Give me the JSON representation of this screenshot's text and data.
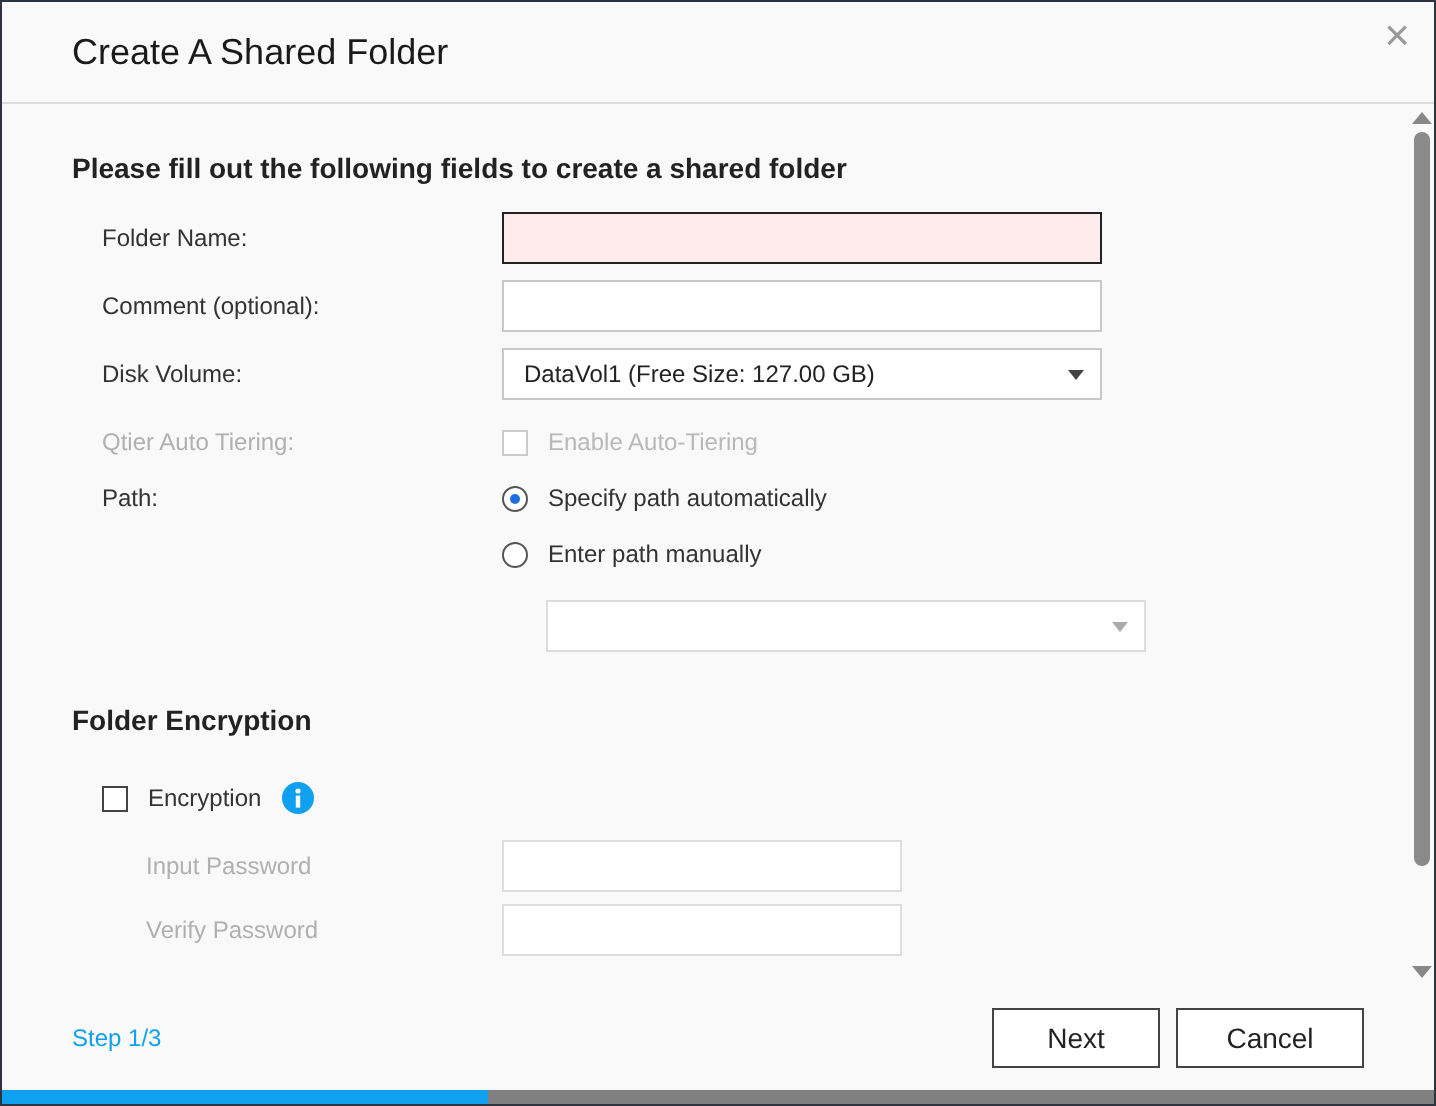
{
  "dialog": {
    "title": "Create A Shared Folder",
    "close": "×"
  },
  "intro": "Please fill out the following fields to create a shared folder",
  "fields": [
    {
      "kind": "text",
      "label": "Folder Name:",
      "focused": true,
      "invalid": true
    },
    {
      "kind": "text",
      "label": "Comment (optional):",
      "focused": false,
      "invalid": false
    },
    {
      "kind": "select",
      "label": "Disk Volume:",
      "value": "DataVol1 (Free Size: 127.00 GB)"
    },
    {
      "kind": "checkbox",
      "label": "Qtier Auto Tiering:",
      "option": "Enable Auto-Tiering",
      "checked": false,
      "disabled": true
    },
    {
      "kind": "radio",
      "label": "Path:",
      "options": [
        {
          "label": "Specify path automatically",
          "selected": true
        },
        {
          "label": "Enter path manually",
          "selected": false
        }
      ]
    }
  ],
  "encryption": {
    "heading": "Folder Encryption",
    "label": "Encryption",
    "checked": false,
    "password_label": "Input Password",
    "verify_label": "Verify Password"
  },
  "footer": {
    "step": "Step 1/3",
    "buttons": [
      "Next",
      "Cancel"
    ]
  },
  "progress": {
    "level": 0.34
  }
}
